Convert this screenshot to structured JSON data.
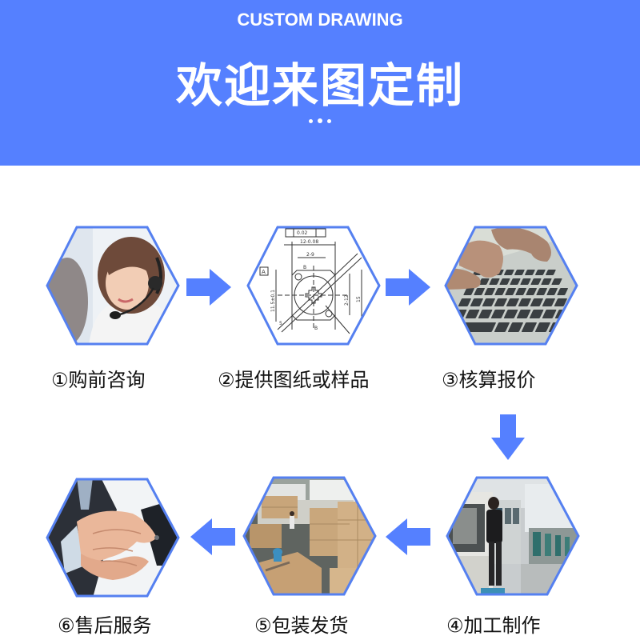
{
  "header": {
    "subtitle": "CUSTOM DRAWING",
    "title": "欢迎来图定制",
    "background_color": "#5580ff"
  },
  "accent_color": "#5580f0",
  "steps": [
    {
      "label": "①购前咨询",
      "image": "customer-service-agent-with-headset"
    },
    {
      "label": "②提供图纸或样品",
      "image": "technical-drawing"
    },
    {
      "label": "③核算报价",
      "image": "hands-typing-on-keyboard"
    },
    {
      "label": "④加工制作",
      "image": "factory-machining-workshop"
    },
    {
      "label": "⑤包装发货",
      "image": "packed-boxes-and-truck"
    },
    {
      "label": "⑥售后服务",
      "image": "business-handshake"
    }
  ],
  "arrows": [
    "arrow-right",
    "arrow-right",
    "arrow-down",
    "arrow-left",
    "arrow-left"
  ],
  "drawing_annotations": {
    "top_tol": "0.02",
    "width_dim": "12-0.08",
    "hole_dim": "2-9",
    "height_dim": "11.5±0.1",
    "inner_dim": "2-12",
    "outer_dim": "15",
    "datum": "A",
    "section": "B",
    "radius": "5"
  }
}
